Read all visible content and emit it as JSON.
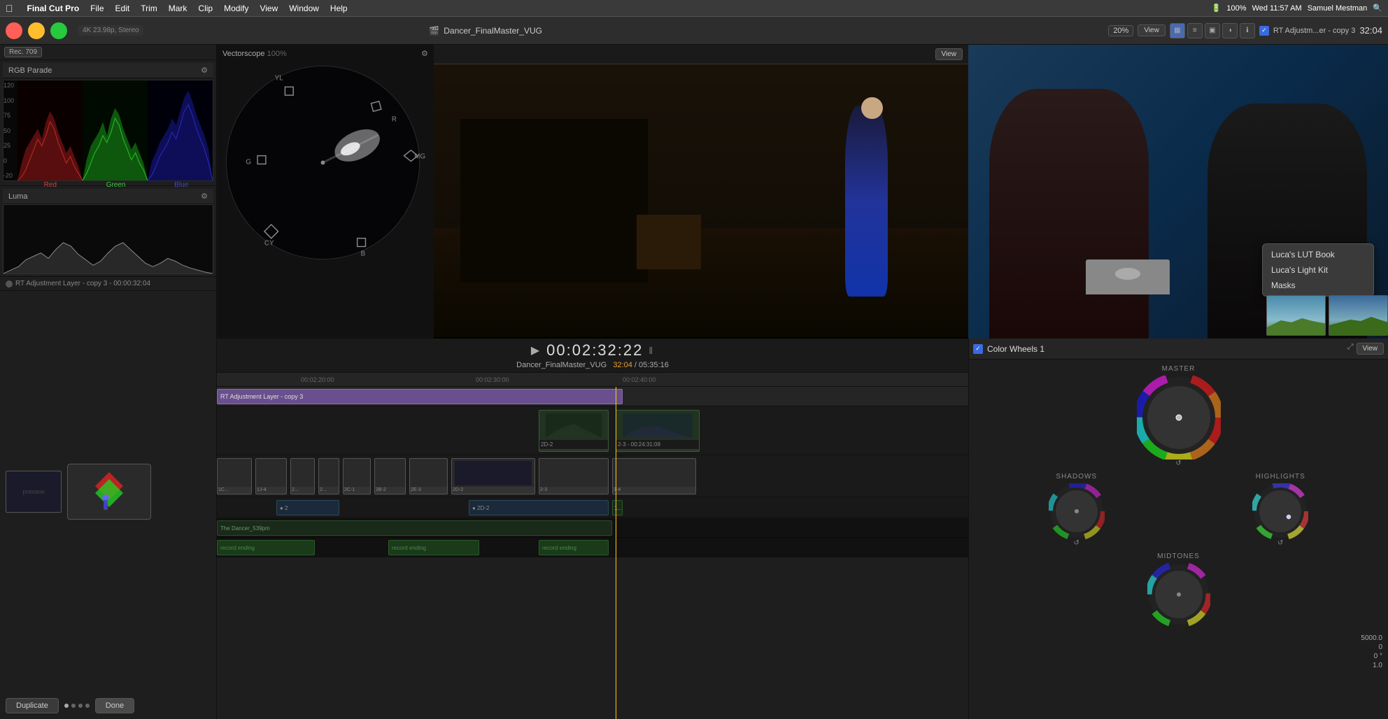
{
  "menubar": {
    "apple": "⌘",
    "app_name": "Final Cut Pro",
    "items": [
      "File",
      "Edit",
      "Trim",
      "Mark",
      "Clip",
      "Modify",
      "View",
      "Window",
      "Help"
    ],
    "right": {
      "battery": "100%",
      "time": "Wed 11:57 AM",
      "user": "Samuel Mestman"
    }
  },
  "toolbar": {
    "filename": "Dancer_FinalMaster_VUG",
    "view_label": "View",
    "percent": "20%",
    "timecode_right": "32:04",
    "effect_name": "RT Adjustm...er - copy 3",
    "icons": [
      "grid",
      "list",
      "clip",
      "color",
      "info"
    ]
  },
  "left_panel": {
    "rgb_parade_label": "RGB Parade",
    "luma_label": "Luma",
    "scale": [
      "120",
      "100",
      "75",
      "50",
      "25",
      "0",
      "-20"
    ],
    "channels": [
      "Red",
      "Green",
      "Blue"
    ],
    "rec_label": "Rec. 709",
    "clip_info": "RT Adjustment Layer - copy 3 - 00:00:32:04",
    "duplicate_btn": "Duplicate",
    "done_btn": "Done",
    "dots": [
      "•",
      "•",
      "•",
      "•"
    ]
  },
  "vectorscope": {
    "label": "Vectorscope",
    "percent": "100%",
    "markers": [
      "R",
      "MG",
      "B",
      "CY",
      "G",
      "YL"
    ]
  },
  "playback": {
    "timecode": "00:02:32:22",
    "clip_name": "Dancer_FinalMaster_VUG",
    "position": "32:04",
    "duration": "05:35:16"
  },
  "timeline": {
    "ruler_marks": [
      "00:02:20:00",
      "00:02:30:00",
      "00:02:40:00"
    ],
    "tracks": [
      {
        "label": "RT Adjustment Layer - copy 3",
        "type": "adjustment"
      },
      {
        "label": "2D-2",
        "type": "video"
      },
      {
        "label": "2-3 - 00:24:31:09",
        "type": "video"
      },
      {
        "label": "1C... 1J-4 2... 2... 2C-1 2B-2 2E-3 2D-2 2-3 3-4",
        "type": "main"
      },
      {
        "label": "2",
        "type": "b-roll"
      },
      {
        "label": "2D-2",
        "type": "b-roll"
      },
      {
        "label": "The Dancer_539pm",
        "type": "audio"
      },
      {
        "label": "record ending",
        "type": "audio"
      }
    ]
  },
  "right_panel": {
    "effect_checkbox_label": "Color Wheels 1",
    "view_btn": "View",
    "master_label": "MASTER",
    "shadows_label": "SHADOWS",
    "highlights_label": "HIGHLIGHTS",
    "midtones_label": "MIDTONES",
    "values": {
      "top": "5000.0",
      "mid1": "0",
      "mid2": "0 °",
      "bottom": "1.0"
    }
  },
  "preview": {
    "main_scene": "dancer_scene",
    "secondary_scene": "presenters_scene"
  },
  "context_menu": {
    "items": [
      "Luca's LUT Book",
      "Luca's Light Kit",
      "Masks"
    ]
  },
  "thumbnails": [
    "landscape1",
    "landscape2"
  ]
}
